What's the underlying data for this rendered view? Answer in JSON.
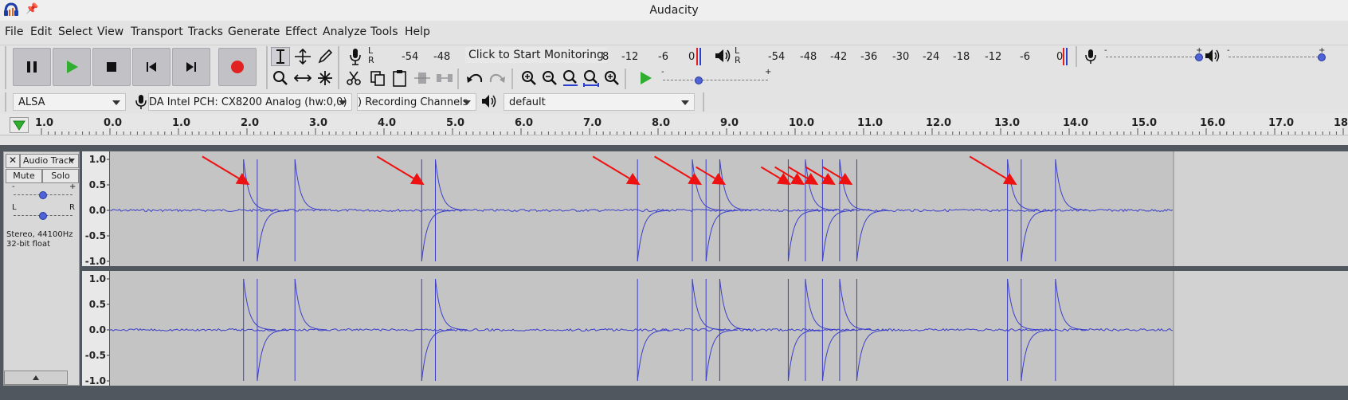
{
  "window": {
    "title": "Audacity"
  },
  "menu": [
    "File",
    "Edit",
    "Select",
    "View",
    "Transport",
    "Tracks",
    "Generate",
    "Effect",
    "Analyze",
    "Tools",
    "Help"
  ],
  "transport": {
    "buttons": [
      "pause",
      "play",
      "stop",
      "skip-to-start",
      "skip-to-end",
      "record"
    ]
  },
  "recording_meter": {
    "lr": "L\nR",
    "ticks": [
      "-54",
      "-48",
      "8",
      "-12",
      "-6",
      "0"
    ],
    "prompt": "Click to Start Monitoring"
  },
  "playback_meter": {
    "lr": "L\nR",
    "ticks": [
      "-54",
      "-48",
      "-42",
      "-36",
      "-30",
      "-24",
      "-18",
      "-12",
      "-6",
      "0"
    ]
  },
  "device": {
    "host": "ALSA",
    "input": "DA Intel PCH: CX8200 Analog (hw:0,0)",
    "channels": ") Recording Channels",
    "output": "default"
  },
  "ruler": {
    "labels": [
      "1.0",
      "0.0",
      "1.0",
      "2.0",
      "3.0",
      "4.0",
      "5.0",
      "6.0",
      "7.0",
      "8.0",
      "9.0",
      "10.0",
      "11.0",
      "12.0",
      "13.0",
      "14.0",
      "15.0",
      "16.0",
      "17.0",
      "18."
    ]
  },
  "track": {
    "name": "Audio Track",
    "mute": "Mute",
    "solo": "Solo",
    "gain_min": "-",
    "gain_max": "+",
    "pan_left": "L",
    "pan_right": "R",
    "info": "Stereo, 44100Hz",
    "format": "32-bit float",
    "scale": [
      "1.0",
      "0.5",
      "0.0",
      "-0.5",
      "-1.0"
    ]
  },
  "colors": {
    "waveform": "#3a3ec8",
    "wave_bg": "#c4c4c4",
    "arrow": "#ee1111",
    "record": "#e22222",
    "play": "#2fae2f"
  },
  "spikes_seconds": [
    1.95,
    2.15,
    2.7,
    4.55,
    4.75,
    7.7,
    8.5,
    8.7,
    8.9,
    9.9,
    10.15,
    10.4,
    10.65,
    10.9,
    13.1,
    13.3,
    13.8
  ],
  "arrows_seconds": [
    2.0,
    4.55,
    7.7,
    8.6,
    8.95,
    9.9,
    10.1,
    10.3,
    10.55,
    10.8,
    13.2
  ]
}
